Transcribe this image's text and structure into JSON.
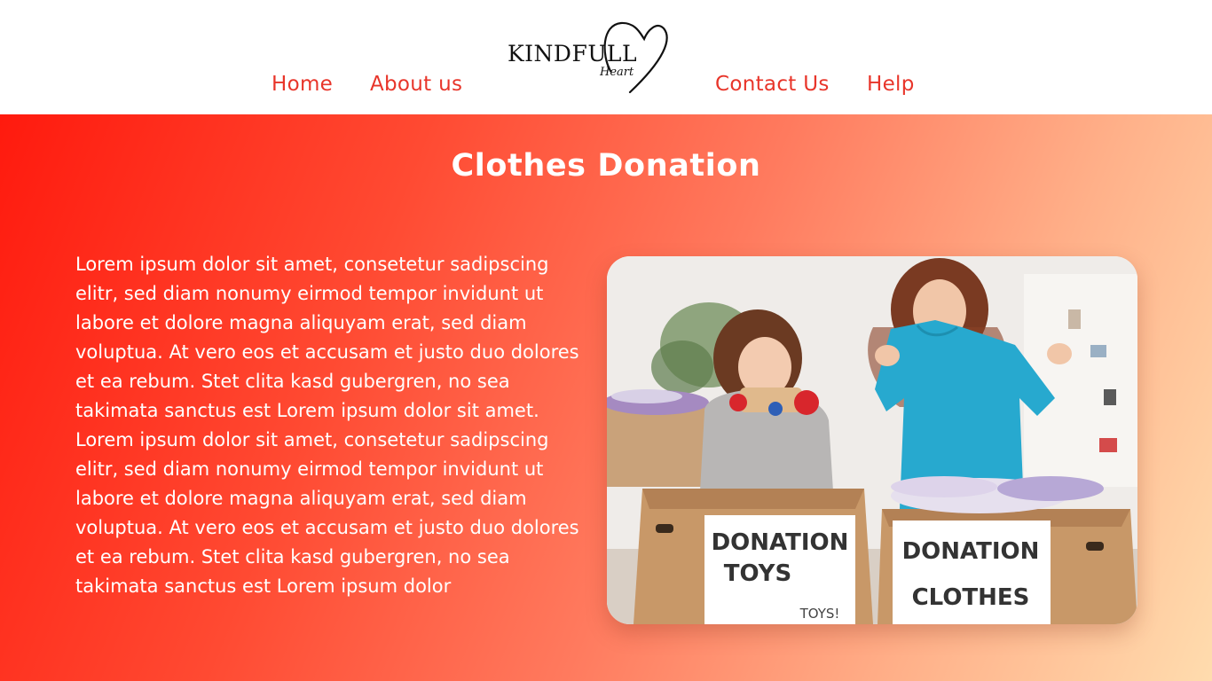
{
  "nav": {
    "left": [
      {
        "label": "Home"
      },
      {
        "label": "About us"
      }
    ],
    "right": [
      {
        "label": "Contact Us"
      },
      {
        "label": "Help"
      }
    ]
  },
  "logo": {
    "wordmark": "KINDFULL",
    "script": "Heart"
  },
  "hero": {
    "title": "Clothes Donation",
    "body": "Lorem ipsum dolor sit amet, consetetur sadipscing elitr, sed diam nonumy eirmod tempor invidunt ut labore et dolore magna aliquyam erat, sed diam voluptua. At vero eos et accusam et justo duo dolores et ea rebum. Stet clita kasd gubergren, no sea takimata sanctus est Lorem ipsum dolor sit amet. Lorem ipsum dolor sit amet, consetetur sadipscing elitr, sed diam nonumy eirmod tempor invidunt ut labore et dolore magna aliquyam erat, sed diam voluptua. At vero eos et accusam et justo duo dolores et ea rebum. Stet clita kasd gubergren, no sea takimata sanctus est Lorem ipsum dolor",
    "image": {
      "box_left_line1": "DONATION",
      "box_left_line2": "TOYS",
      "box_left_note": "TOYS!",
      "box_right_line1": "DONATION",
      "box_right_line2": "CLOTHES"
    }
  },
  "colors": {
    "accent": "#e8352a",
    "gradient_start": "#ff1a0e",
    "gradient_end": "#ffdcae"
  }
}
